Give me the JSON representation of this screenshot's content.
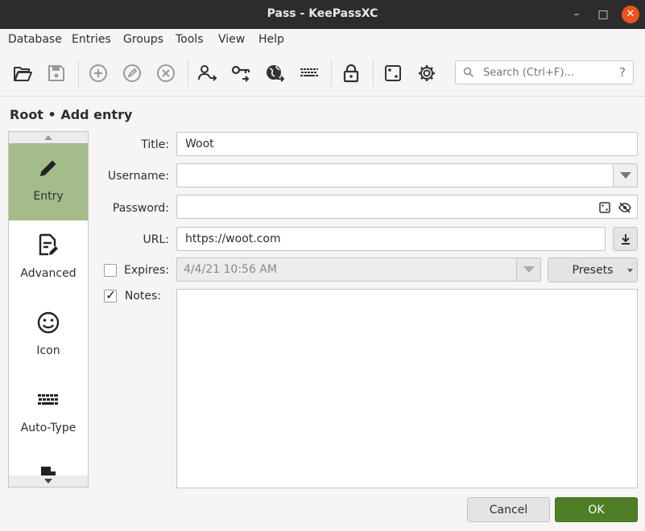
{
  "window": {
    "title": "Pass - KeePassXC"
  },
  "menu": [
    "Database",
    "Entries",
    "Groups",
    "Tools",
    "View",
    "Help"
  ],
  "search": {
    "placeholder": "Search (Ctrl+F)...",
    "help": "?"
  },
  "heading": "Root • Add entry",
  "sidebar": [
    {
      "label": "Entry",
      "icon": "pencil-icon",
      "active": true
    },
    {
      "label": "Advanced",
      "icon": "document-edit-icon",
      "active": false
    },
    {
      "label": "Icon",
      "icon": "smiley-icon",
      "active": false
    },
    {
      "label": "Auto-Type",
      "icon": "keyboard-icon",
      "active": false
    }
  ],
  "form": {
    "title_label": "Title:",
    "title_value": "Woot",
    "username_label": "Username:",
    "username_value": "",
    "password_label": "Password:",
    "password_value": "",
    "url_label": "URL:",
    "url_value": "https://woot.com",
    "expires_label": "Expires:",
    "expires_checked": false,
    "expires_value": "4/4/21 10:56 AM",
    "presets_label": "Presets",
    "notes_label": "Notes:",
    "notes_checked": true,
    "notes_value": ""
  },
  "buttons": {
    "cancel": "Cancel",
    "ok": "OK"
  },
  "colors": {
    "accent_green": "#4e7f26",
    "active_tab": "#a4bb8a",
    "close_orange": "#e95420"
  }
}
